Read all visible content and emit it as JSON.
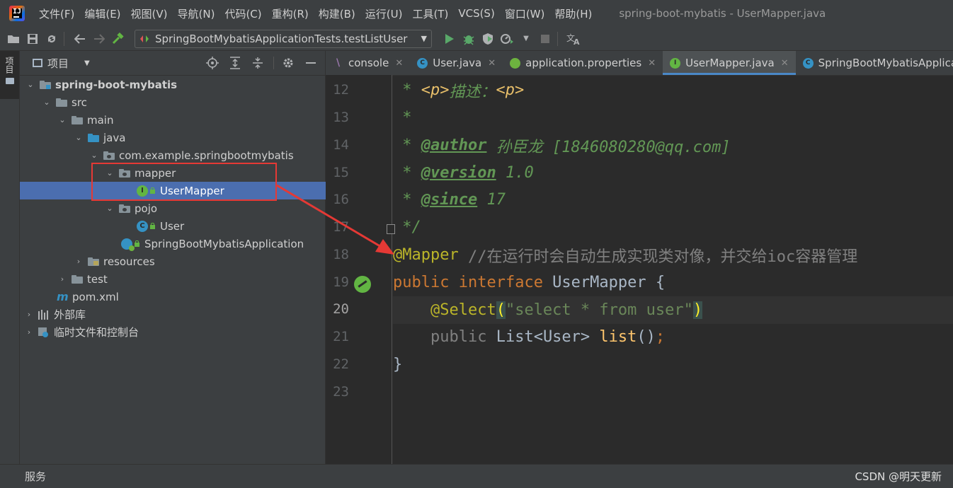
{
  "menubar": {
    "items": [
      "文件(F)",
      "编辑(E)",
      "视图(V)",
      "导航(N)",
      "代码(C)",
      "重构(R)",
      "构建(B)",
      "运行(U)",
      "工具(T)",
      "VCS(S)",
      "窗口(W)",
      "帮助(H)"
    ],
    "window_title": "spring-boot-mybatis - UserMapper.java"
  },
  "toolbar": {
    "run_config": "SpringBootMybatisApplicationTests.testListUser",
    "icons": [
      "open-icon",
      "save-icon",
      "sync-icon",
      "back-icon",
      "forward-icon",
      "build-icon",
      "run-icon",
      "debug-icon",
      "coverage-icon",
      "profile-icon",
      "stop-icon",
      "translate-icon"
    ]
  },
  "left_stripe": {
    "project_label": "项目"
  },
  "project_panel": {
    "title": "项目",
    "tree": [
      {
        "label": "spring-boot-mybatis",
        "icon": "module-folder",
        "expanded": true
      },
      {
        "label": "src",
        "icon": "folder",
        "expanded": true
      },
      {
        "label": "main",
        "icon": "folder",
        "expanded": true
      },
      {
        "label": "java",
        "icon": "source-folder",
        "expanded": true
      },
      {
        "label": "com.example.springbootmybatis",
        "icon": "package",
        "expanded": true
      },
      {
        "label": "mapper",
        "icon": "package",
        "expanded": true
      },
      {
        "label": "UserMapper",
        "icon": "interface",
        "selected": true
      },
      {
        "label": "pojo",
        "icon": "package",
        "expanded": true
      },
      {
        "label": "User",
        "icon": "class"
      },
      {
        "label": "SpringBootMybatisApplication",
        "icon": "spring-boot-class"
      },
      {
        "label": "resources",
        "icon": "resources-folder",
        "expanded": false
      },
      {
        "label": "test",
        "icon": "folder",
        "expanded": false
      },
      {
        "label": "pom.xml",
        "icon": "maven"
      },
      {
        "label": "外部库",
        "icon": "libraries",
        "expanded": false
      },
      {
        "label": "临时文件和控制台",
        "icon": "scratches",
        "expanded": false
      }
    ]
  },
  "editor": {
    "tabs": [
      {
        "label": "console",
        "icon": "console"
      },
      {
        "label": "User.java",
        "icon": "class"
      },
      {
        "label": "application.properties",
        "icon": "spring"
      },
      {
        "label": "UserMapper.java",
        "icon": "interface",
        "active": true
      },
      {
        "label": "SpringBootMybatisApplica",
        "icon": "class"
      }
    ],
    "line_numbers": [
      "12",
      "13",
      "14",
      "15",
      "16",
      "17",
      "18",
      "19",
      "20",
      "21",
      "22",
      "23"
    ],
    "current_line": "20",
    "code": {
      "l12_star": " * ",
      "l12_p1": "<p>",
      "l12_text": "描述：",
      "l12_p2": "<p>",
      "l13": " *",
      "l14_star": " * ",
      "l14_tag": "@author",
      "l14_text": " 孙臣龙 [1846080280@qq.com]",
      "l15_star": " * ",
      "l15_tag": "@version",
      "l15_text": " 1.0",
      "l16_star": " * ",
      "l16_tag": "@since",
      "l16_text": " 17",
      "l17": " */",
      "l18_anno": "@Mapper",
      "l18_comment": " //在运行时会自动生成实现类对像，并交给ioc容器管理",
      "l19_kw1": "public",
      "l19_kw2": " interface",
      "l19_name": " UserMapper {",
      "l20_indent": "    ",
      "l20_anno": "@Select",
      "l20_paren1": "(",
      "l20_str": "\"select * from user\"",
      "l20_paren2": ")",
      "l21_indent": "    ",
      "l21_kw": "public",
      "l21_type": " List<User> ",
      "l21_fn": "list",
      "l21_rest": "()",
      "l21_semi": ";",
      "l22": "}"
    }
  },
  "statusbar": {
    "services": "服务",
    "watermark": "CSDN @明天更新"
  },
  "colors": {
    "selection": "#4b6eaf",
    "highlight_box": "#e53935",
    "arrow": "#e53935",
    "annotation": "#bbb529",
    "keyword": "#cc7832",
    "doc_comment": "#629755"
  }
}
